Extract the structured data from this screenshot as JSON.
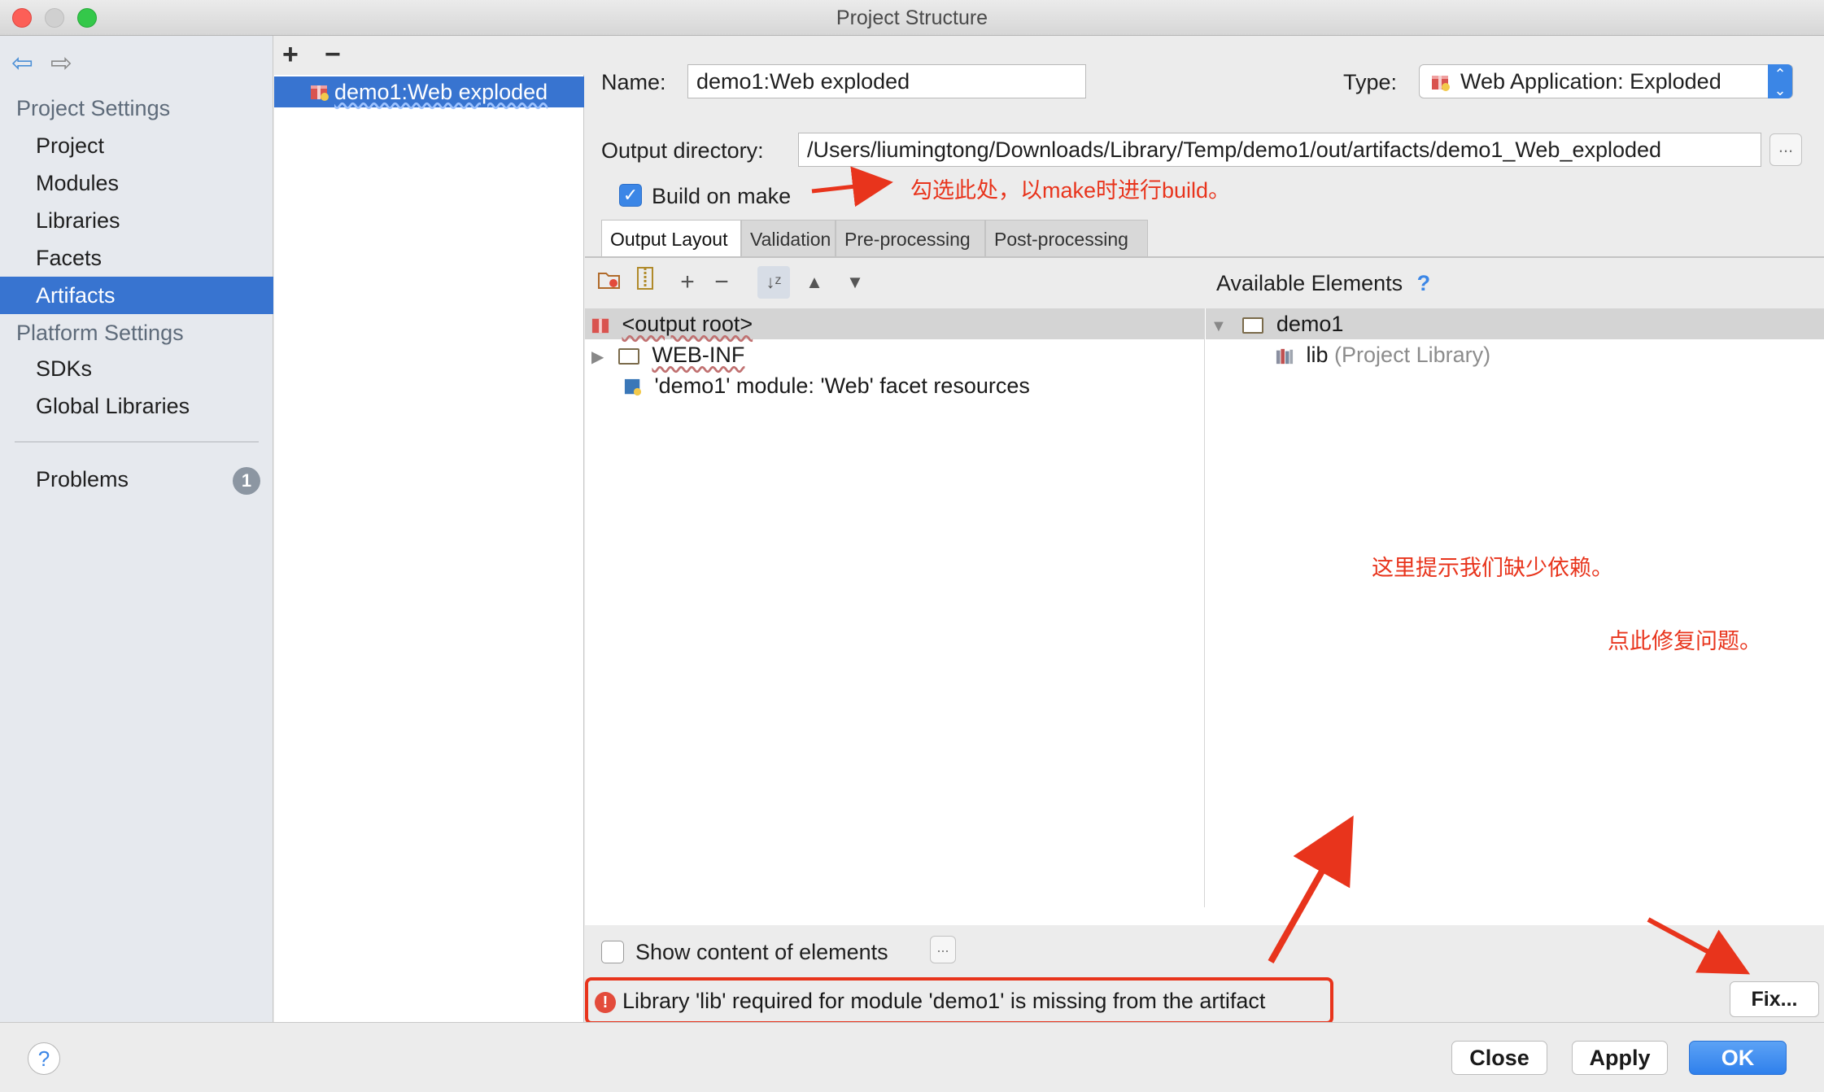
{
  "window": {
    "title": "Project Structure"
  },
  "nav": {
    "project_settings_header": "Project Settings",
    "project_items": [
      "Project",
      "Modules",
      "Libraries",
      "Facets",
      "Artifacts"
    ],
    "platform_settings_header": "Platform Settings",
    "platform_items": [
      "SDKs",
      "Global Libraries"
    ],
    "problems_label": "Problems",
    "problems_count": "1",
    "selected": "Artifacts"
  },
  "artifacts": {
    "add": "+",
    "remove": "−",
    "items": [
      "demo1:Web exploded"
    ]
  },
  "form": {
    "name_label": "Name:",
    "name_value": "demo1:Web exploded",
    "type_label": "Type:",
    "type_value": "Web Application: Exploded",
    "output_label": "Output directory:",
    "output_value": "/Users/liumingtong/Downloads/Library/Temp/demo1/out/artifacts/demo1_Web_exploded",
    "browse": "...",
    "build_on_make": "Build on make",
    "build_checked": true
  },
  "annotations": {
    "build_note": "勾选此处，以make时进行build。",
    "missing_note": "这里提示我们缺少依赖。",
    "fix_note": "点此修复问题。"
  },
  "tabs": [
    "Output Layout",
    "Validation",
    "Pre-processing",
    "Post-processing"
  ],
  "layout": {
    "available_header": "Available Elements",
    "help": "?",
    "left_tree": [
      {
        "label": "<output root>"
      },
      {
        "label": "WEB-INF"
      },
      {
        "label": "'demo1' module: 'Web' facet resources"
      }
    ],
    "right_tree": [
      {
        "label": "demo1"
      },
      {
        "label": "lib",
        "suffix": "(Project Library)"
      }
    ],
    "show_content": "Show content of elements",
    "show_more": "..."
  },
  "error": {
    "text": "Library 'lib' required for module 'demo1' is missing from the artifact",
    "fix": "Fix..."
  },
  "footer": {
    "help": "?",
    "close": "Close",
    "apply": "Apply",
    "ok": "OK"
  },
  "colors": {
    "accent": "#3874d0",
    "annotation": "#e8341c",
    "primary": "#2f80ec"
  }
}
